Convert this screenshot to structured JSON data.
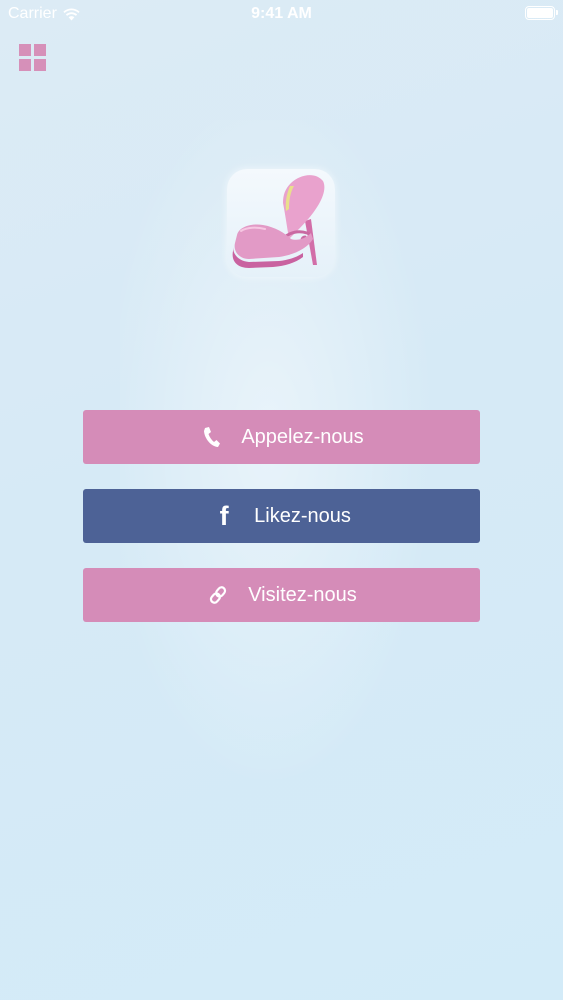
{
  "status_bar": {
    "carrier": "Carrier",
    "time": "9:41 AM",
    "wifi_icon": "wifi-icon",
    "battery_icon": "battery-icon"
  },
  "menu": {
    "icon": "grid-menu-icon"
  },
  "logo": {
    "icon": "high-heel-shoe-icon"
  },
  "buttons": {
    "call": {
      "label": "Appelez-nous",
      "icon": "phone-icon",
      "color": "#d58cb8"
    },
    "like": {
      "label": "Likez-nous",
      "icon": "facebook-icon",
      "color": "#4d6296"
    },
    "visit": {
      "label": "Visitez-nous",
      "icon": "link-icon",
      "color": "#d58cb8"
    }
  },
  "colors": {
    "accent_pink": "#d690b9",
    "facebook_blue": "#4d6296",
    "background": "#d6eaf6"
  }
}
